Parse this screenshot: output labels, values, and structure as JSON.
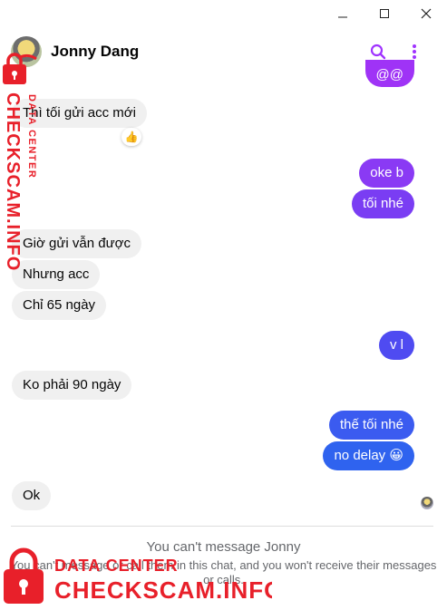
{
  "window": {
    "minimize": "—",
    "maximize": "☐",
    "close": "✕"
  },
  "header": {
    "title": "Jonny Dang",
    "search_icon": "search-icon",
    "more_icon": "more-vertical-icon"
  },
  "colors": {
    "accent": "#a033ff",
    "bubble_purple_top": "#9b34f3",
    "bubble_purple_mid": "#7b3cf3",
    "bubble_blue": "#4a4ef0",
    "bubble_blue_bottom": "#2f63ef",
    "incoming": "#f0f0f0",
    "watermark": "#e8202a"
  },
  "messages": [
    {
      "from": "me",
      "text": "@@"
    },
    {
      "from": "them",
      "text": "Thì tối gửi acc mới",
      "reaction": "👍"
    },
    {
      "from": "me",
      "text": "oke b"
    },
    {
      "from": "me",
      "text": "tối nhé"
    },
    {
      "from": "them",
      "text": "Giờ gửi vẫn được"
    },
    {
      "from": "them",
      "text": "Nhưng acc"
    },
    {
      "from": "them",
      "text": "Chỉ 65 ngày"
    },
    {
      "from": "me",
      "text": "v l"
    },
    {
      "from": "them",
      "text": "Ko phải 90 ngày"
    },
    {
      "from": "me",
      "text": "thế tối nhé"
    },
    {
      "from": "me",
      "text": "no delay 😀"
    },
    {
      "from": "them",
      "text": "Ok"
    }
  ],
  "notice": {
    "title": "You can't message Jonny",
    "subtitle": "You can't message or call them in this chat, and you won't receive their messages or calls."
  },
  "watermark": {
    "line1": "DATA CENTER",
    "line2": "CHECKSCAM.INFO",
    "vertical_line1": "DATA CENTER",
    "vertical_line2": "CHECKSCAM.INFO"
  }
}
